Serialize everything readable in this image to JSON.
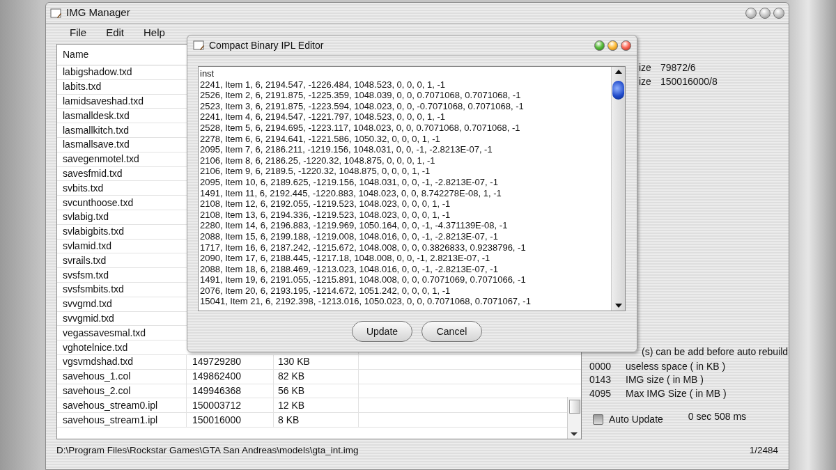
{
  "main_window": {
    "title": "IMG Manager",
    "menu": [
      "File",
      "Edit",
      "Help"
    ],
    "table": {
      "columns": [
        "Name"
      ],
      "rows": [
        {
          "name": "labigshadow.txd"
        },
        {
          "name": "labits.txd"
        },
        {
          "name": "lamidsaveshad.txd"
        },
        {
          "name": "lasmalldesk.txd"
        },
        {
          "name": "lasmallkitch.txd"
        },
        {
          "name": "lasmallsave.txd"
        },
        {
          "name": "savegenmotel.txd"
        },
        {
          "name": "savesfmid.txd"
        },
        {
          "name": "svbits.txd"
        },
        {
          "name": "svcunthoose.txd"
        },
        {
          "name": "svlabig.txd"
        },
        {
          "name": "svlabigbits.txd"
        },
        {
          "name": "svlamid.txd"
        },
        {
          "name": "svrails.txd"
        },
        {
          "name": "svsfsm.txd"
        },
        {
          "name": "svsfsmbits.txd"
        },
        {
          "name": "svvgmd.txd"
        },
        {
          "name": "svvgmid.txd"
        },
        {
          "name": "vegassavesmal.txd"
        },
        {
          "name": "vghotelnice.txd"
        },
        {
          "name": "vgsvmdshad.txd",
          "column_2": "149729280",
          "column_3": "130 KB"
        },
        {
          "name": "savehous_1.col",
          "column_2": "149862400",
          "column_3": "82 KB"
        },
        {
          "name": "savehous_2.col",
          "column_2": "149946368",
          "column_3": "56 KB"
        },
        {
          "name": "savehous_stream0.ipl",
          "column_2": "150003712",
          "column_3": "12 KB"
        },
        {
          "name": "savehous_stream1.ipl",
          "column_2": "150016000",
          "column_3": "8 KB"
        }
      ]
    },
    "sizes": [
      {
        "label": "ize",
        "value": "79872/6"
      },
      {
        "label": "ize",
        "value": "150016000/8"
      }
    ],
    "rebuild_note": "(s) can be add before auto rebuild",
    "stats": [
      {
        "value": "0000",
        "label": "useless space ( in KB )"
      },
      {
        "value": "0143",
        "label": "IMG size ( in MB )"
      },
      {
        "value": "4095",
        "label": "Max IMG Size ( in MB )"
      }
    ],
    "auto_update": {
      "label": "Auto Update",
      "checked": false
    },
    "timing": "0 sec 508 ms",
    "path": "D:\\Program Files\\Rockstar Games\\GTA San Andreas\\models\\gta_int.img",
    "count": "1/2484"
  },
  "dialog": {
    "title": "Compact Binary IPL Editor",
    "lines": [
      "inst",
      "2241, Item 1, 6, 2194.547, -1226.484, 1048.523, 0, 0, 0, 1, -1",
      "2526, Item 2, 6, 2191.875, -1225.359, 1048.039, 0, 0, 0.7071068, 0.7071068, -1",
      "2523, Item 3, 6, 2191.875, -1223.594, 1048.023, 0, 0, -0.7071068, 0.7071068, -1",
      "2241, Item 4, 6, 2194.547, -1221.797, 1048.523, 0, 0, 0, 1, -1",
      "2528, Item 5, 6, 2194.695, -1223.117, 1048.023, 0, 0, 0.7071068, 0.7071068, -1",
      "2278, Item 6, 6, 2194.641, -1221.586, 1050.32, 0, 0, 0, 1, -1",
      "2095, Item 7, 6, 2186.211, -1219.156, 1048.031, 0, 0, -1, -2.8213E-07, -1",
      "2106, Item 8, 6, 2186.25, -1220.32, 1048.875, 0, 0, 0, 1, -1",
      "2106, Item 9, 6, 2189.5, -1220.32, 1048.875, 0, 0, 0, 1, -1",
      "2095, Item 10, 6, 2189.625, -1219.156, 1048.031, 0, 0, -1, -2.8213E-07, -1",
      "1491, Item 11, 6, 2192.445, -1220.883, 1048.023, 0, 0, 8.742278E-08, 1, -1",
      "2108, Item 12, 6, 2192.055, -1219.523, 1048.023, 0, 0, 0, 1, -1",
      "2108, Item 13, 6, 2194.336, -1219.523, 1048.023, 0, 0, 0, 1, -1",
      "2280, Item 14, 6, 2196.883, -1219.969, 1050.164, 0, 0, -1, -4.371139E-08, -1",
      "2088, Item 15, 6, 2199.188, -1219.008, 1048.016, 0, 0, -1, -2.8213E-07, -1",
      "1717, Item 16, 6, 2187.242, -1215.672, 1048.008, 0, 0, 0.3826833, 0.9238796, -1",
      "2090, Item 17, 6, 2188.445, -1217.18, 1048.008, 0, 0, -1, 2.8213E-07, -1",
      "2088, Item 18, 6, 2188.469, -1213.023, 1048.016, 0, 0, -1, -2.8213E-07, -1",
      "1491, Item 19, 6, 2191.055, -1215.891, 1048.008, 0, 0, 0.7071069, 0.7071066, -1",
      "2076, Item 20, 6, 2193.195, -1214.672, 1051.242, 0, 0, 0, 1, -1",
      "15041, Item 21, 6, 2192.398, -1213.016, 1050.023, 0, 0, 0.7071068, 0.7071067, -1"
    ],
    "buttons": [
      "Update",
      "Cancel"
    ]
  }
}
